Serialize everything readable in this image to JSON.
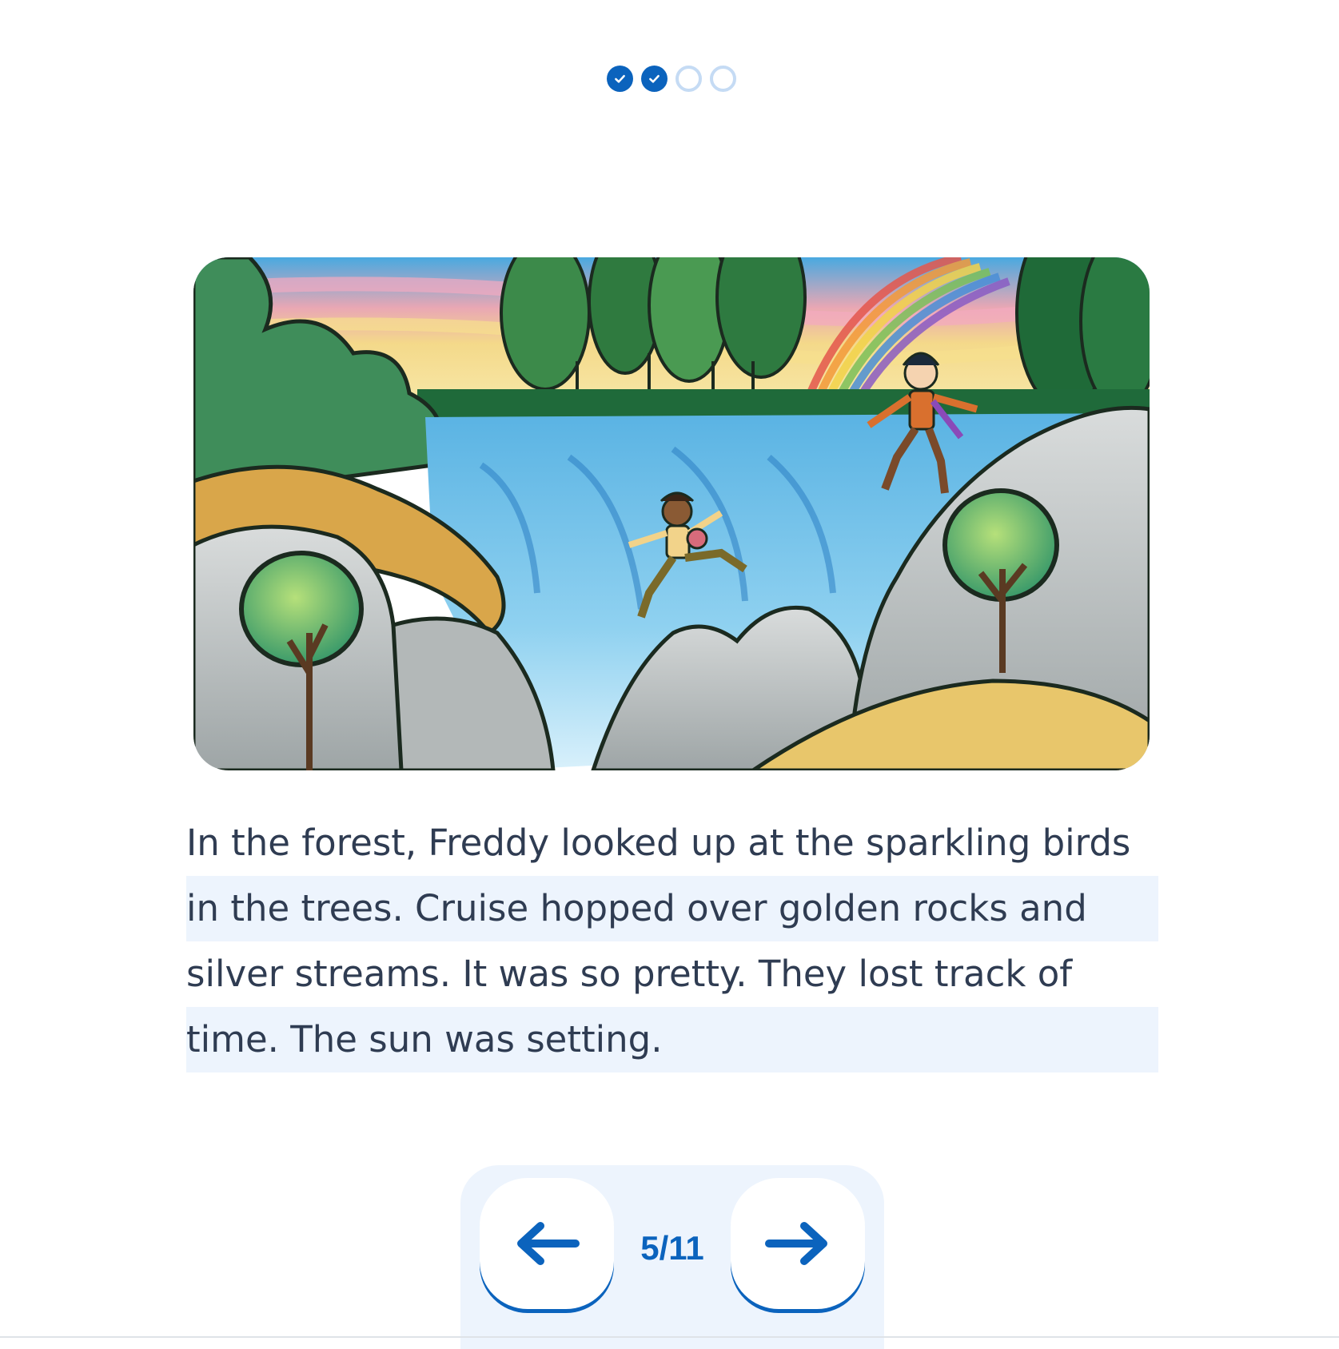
{
  "progress": {
    "steps": [
      {
        "state": "done",
        "icon": "check-icon"
      },
      {
        "state": "done",
        "icon": "check-icon"
      },
      {
        "state": "todo"
      },
      {
        "state": "todo"
      }
    ],
    "completed": 2,
    "total": 4
  },
  "illustration": {
    "subject": "waterfall-scene-illustration"
  },
  "story": {
    "lines": [
      "In the forest, Freddy looked up at the sparkling birds",
      "in the trees. Cruise hopped over golden rocks and",
      "silver streams. It was so pretty. They lost track of",
      "time. The sun was setting."
    ]
  },
  "pager": {
    "current": "5/11",
    "prev_icon": "arrow-left-icon",
    "next_icon": "arrow-right-icon"
  },
  "colors": {
    "accent": "#0b63bd",
    "highlight": "#edf4fd",
    "text": "#2f3c52"
  }
}
